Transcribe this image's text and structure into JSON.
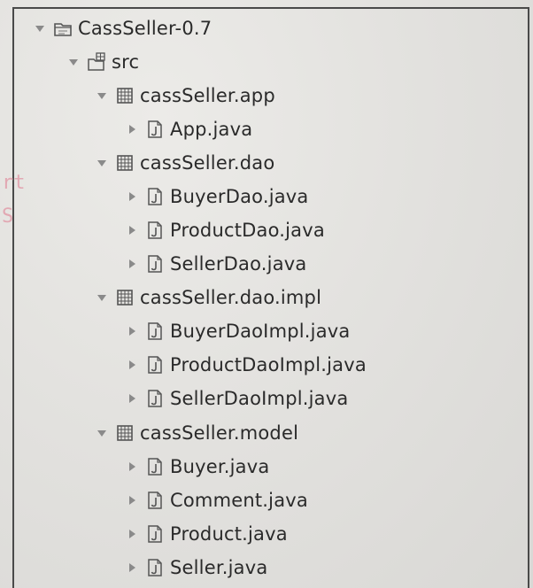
{
  "project": {
    "name": "CassSeller-0.7",
    "icon": "java-project-icon",
    "expanded": true,
    "src": {
      "name": "src",
      "icon": "source-folder-icon",
      "expanded": true,
      "packages": [
        {
          "name": "cassSeller.app",
          "icon": "package-icon",
          "expanded": true,
          "files": [
            {
              "name": "App.java",
              "icon": "java-file-icon"
            }
          ]
        },
        {
          "name": "cassSeller.dao",
          "icon": "package-icon",
          "expanded": true,
          "files": [
            {
              "name": "BuyerDao.java",
              "icon": "java-file-icon"
            },
            {
              "name": "ProductDao.java",
              "icon": "java-file-icon"
            },
            {
              "name": "SellerDao.java",
              "icon": "java-file-icon"
            }
          ]
        },
        {
          "name": "cassSeller.dao.impl",
          "icon": "package-icon",
          "expanded": true,
          "files": [
            {
              "name": "BuyerDaoImpl.java",
              "icon": "java-file-icon"
            },
            {
              "name": "ProductDaoImpl.java",
              "icon": "java-file-icon"
            },
            {
              "name": "SellerDaoImpl.java",
              "icon": "java-file-icon"
            }
          ]
        },
        {
          "name": "cassSeller.model",
          "icon": "package-icon",
          "expanded": true,
          "files": [
            {
              "name": "Buyer.java",
              "icon": "java-file-icon"
            },
            {
              "name": "Comment.java",
              "icon": "java-file-icon"
            },
            {
              "name": "Product.java",
              "icon": "java-file-icon"
            },
            {
              "name": "Seller.java",
              "icon": "java-file-icon"
            }
          ]
        }
      ]
    }
  },
  "background_fragments": [
    "rt",
    "S"
  ],
  "colors": {
    "text": "#2a2a2a",
    "icon": "#555555",
    "background": "#e3e2df",
    "border": "#4a4a4a",
    "fragment": "#e2a8b3"
  }
}
